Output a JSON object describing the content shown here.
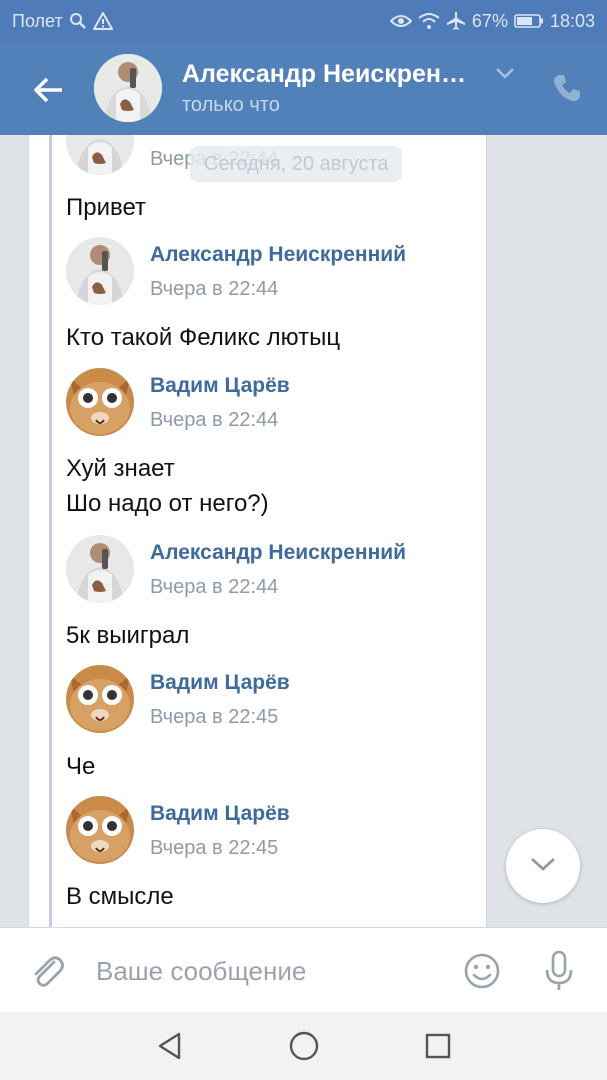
{
  "status_bar": {
    "carrier": "Полет",
    "battery": "67%",
    "time": "18:03",
    "icons": [
      "search-icon",
      "warning-icon",
      "eye-icon",
      "wifi-icon",
      "airplane-icon",
      "battery-icon"
    ]
  },
  "header": {
    "title": "Александр Неискрен…",
    "subtitle": "только что",
    "icons": [
      "back-arrow-icon",
      "chevron-down-icon",
      "phone-icon"
    ]
  },
  "date_divider": "Сегодня, 20 августа",
  "messages": [
    {
      "sender": "",
      "time": "Вчера в 22:44",
      "text": "Привет",
      "avatar": "person-avatar"
    },
    {
      "sender": "Александр Неискренний",
      "time": "Вчера в 22:44",
      "text": "Кто такой Феликс лютыц",
      "avatar": "person-avatar"
    },
    {
      "sender": "Вадим Царёв",
      "time": "Вчера в 22:44",
      "text_lines": [
        "Хуй знает",
        "Шо надо от него?)"
      ],
      "avatar": "cat-avatar"
    },
    {
      "sender": "Александр Неискренний",
      "time": "Вчера в 22:44",
      "text": "5к выиграл",
      "avatar": "person-avatar"
    },
    {
      "sender": "Вадим Царёв",
      "time": "Вчера в 22:45",
      "text": "Че",
      "avatar": "cat-avatar"
    },
    {
      "sender": "Вадим Царёв",
      "time": "Вчера в 22:45",
      "text": "В смысле",
      "avatar": "cat-avatar"
    }
  ],
  "composer": {
    "placeholder": "Ваше сообщение",
    "value": ""
  },
  "colors": {
    "header_bg": "#5181b8",
    "status_bg": "#4f7bb8",
    "sender_name": "#3e6a9c",
    "time_text": "#8d9aa9",
    "page_bg": "#dfe3e8"
  }
}
